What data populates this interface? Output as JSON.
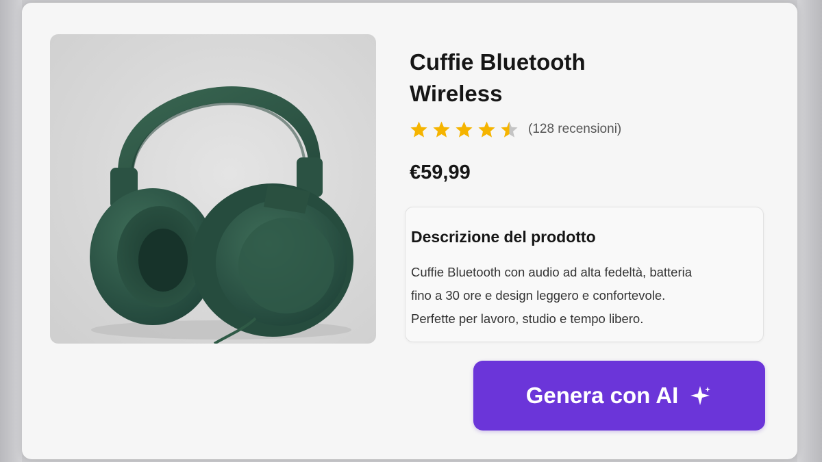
{
  "product": {
    "title_line1": "Cuffie Bluetooth",
    "title_line2": "Wireless",
    "rating": 4.5,
    "rating_max": 5,
    "reviews_text": "(128 recensioni)",
    "price": "€59,99",
    "image_icon": "headphones-product-image"
  },
  "description": {
    "title": "Descrizione del prodotto",
    "line1": "Cuffie Bluetooth con audio ad alta fedeltà, batteria",
    "line2": "fino a 30 ore e design leggero e confortevole.",
    "line3": "Perfette per lavoro, studio e tempo libero."
  },
  "action": {
    "generate_label": "Genera con AI",
    "icon": "sparkle-icon"
  },
  "colors": {
    "accent": "#6b35d9",
    "star": "#f5b400",
    "star_empty": "#c4c4c4",
    "product": "#2f5a46"
  }
}
